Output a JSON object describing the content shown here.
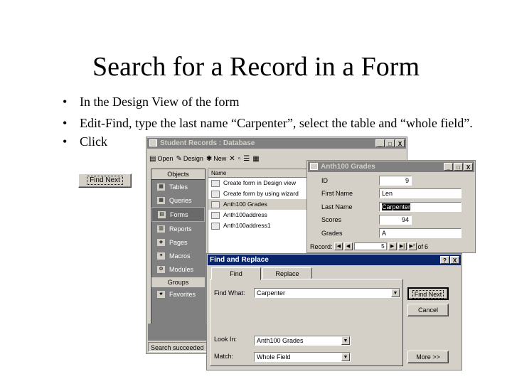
{
  "slide": {
    "title": "Search for a Record in a Form",
    "bullets": [
      "In the Design View of the form",
      "Edit-Find, type the last name “Carpenter”, select the table and “whole field”.",
      "Click"
    ],
    "standalone_button": "Find Next"
  },
  "database_window": {
    "title": "Student Records : Database",
    "toolbar": {
      "open": "Open",
      "design": "Design",
      "new": "New"
    },
    "objects_header": "Objects",
    "objects": [
      "Tables",
      "Queries",
      "Forms",
      "Reports",
      "Pages",
      "Macros",
      "Modules"
    ],
    "selected_object": "Forms",
    "groups_header": "Groups",
    "groups": [
      "Favorites"
    ],
    "list_header": "Name",
    "list_items": [
      "Create form in Design view",
      "Create form by using wizard",
      "Anth100 Grades",
      "Anth100address",
      "Anth100address1"
    ],
    "status": "Search succeeded"
  },
  "grades_form": {
    "title": "Anth100 Grades",
    "fields": [
      {
        "label": "ID",
        "value": "9"
      },
      {
        "label": "First Name",
        "value": "Len"
      },
      {
        "label": "Last Name",
        "value": "Carpenter"
      },
      {
        "label": "Scores",
        "value": "94"
      },
      {
        "label": "Grades",
        "value": "A"
      }
    ],
    "record_label": "Record:",
    "record_current": "5",
    "record_of": "of",
    "record_total": "6"
  },
  "find_dialog": {
    "title": "Find and Replace",
    "tabs": [
      "Find",
      "Replace"
    ],
    "find_what_label": "Find What:",
    "find_what_value": "Carpenter",
    "look_in_label": "Look In:",
    "look_in_value": "Anth100 Grades",
    "match_label": "Match:",
    "match_value": "Whole Field",
    "find_next": "Find Next",
    "cancel": "Cancel",
    "more": "More >>"
  },
  "icons": {
    "help": "?",
    "close": "X",
    "minimize": "_",
    "maximize": "□",
    "dropdown": "▼"
  }
}
